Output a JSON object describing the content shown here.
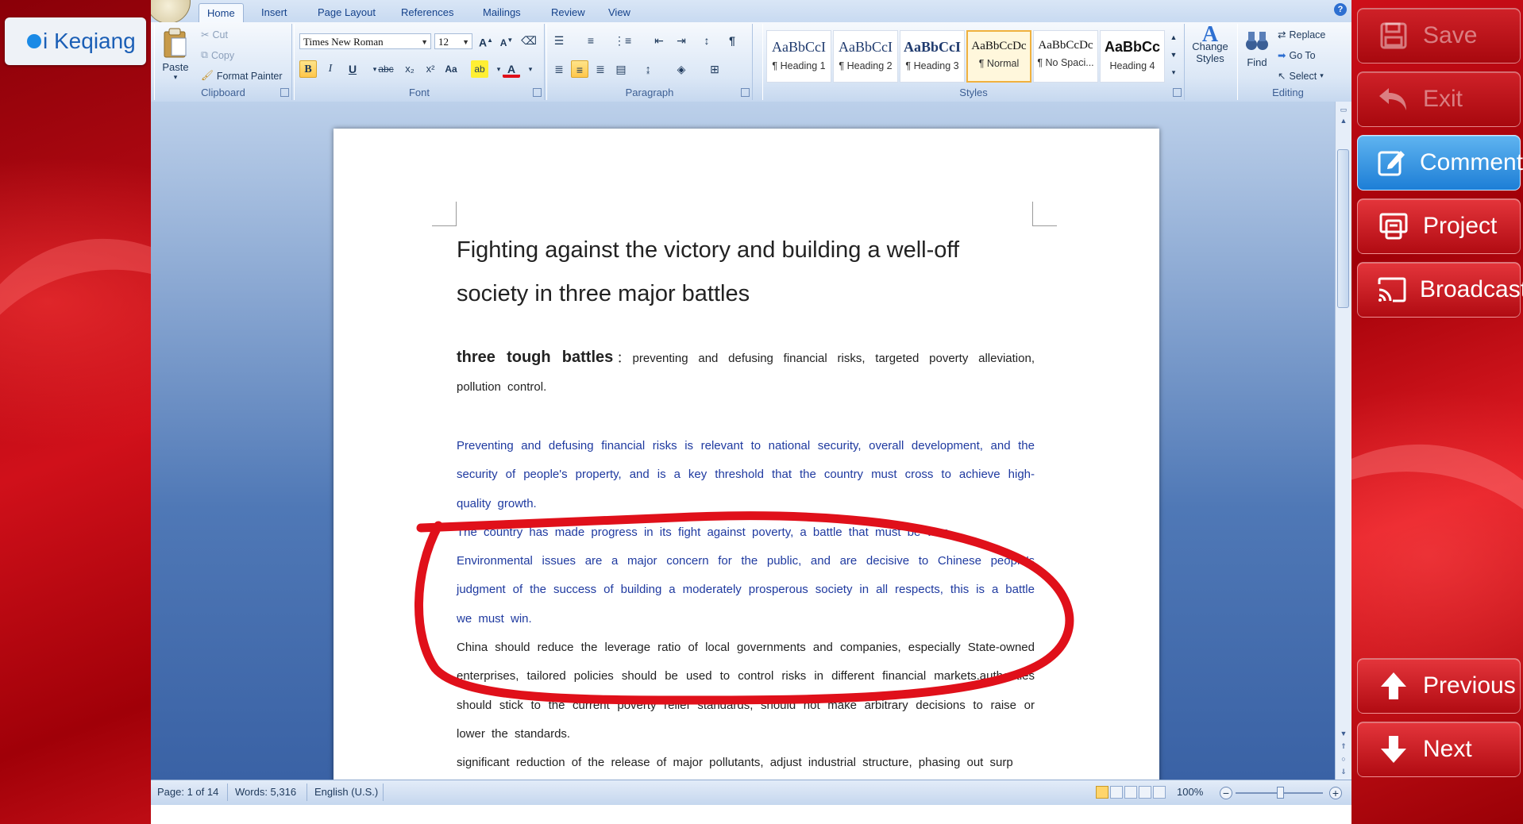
{
  "user": {
    "name": "i Keqiang"
  },
  "ribbon": {
    "tabs": [
      "Home",
      "Insert",
      "Page Layout",
      "References",
      "Mailings",
      "Review",
      "View"
    ],
    "clipboard": {
      "label": "Clipboard",
      "paste": "Paste",
      "cut": "Cut",
      "copy": "Copy",
      "format_painter": "Format Painter"
    },
    "font": {
      "label": "Font",
      "family": "Times New Roman",
      "size": "12",
      "bold": "B",
      "italic": "I",
      "underline": "U",
      "strike": "abc",
      "subscript": "x₂",
      "superscript": "x²",
      "change_case": "Aa"
    },
    "paragraph": {
      "label": "Paragraph"
    },
    "styles": {
      "label": "Styles",
      "items": [
        {
          "sample": "AaBbCcI",
          "name": "¶ Heading 1"
        },
        {
          "sample": "AaBbCcI",
          "name": "¶ Heading 2"
        },
        {
          "sample": "AaBbCcI",
          "name": "¶ Heading 3"
        },
        {
          "sample": "AaBbCcDc",
          "name": "¶ Normal"
        },
        {
          "sample": "AaBbCcDc",
          "name": "¶ No Spaci..."
        },
        {
          "sample": "AaBbCc",
          "name": "Heading 4"
        }
      ],
      "change_styles": "Change Styles"
    },
    "editing": {
      "label": "Editing",
      "find": "Find",
      "replace": "Replace",
      "goto": "Go To",
      "select": "Select"
    }
  },
  "document": {
    "title": "Fighting against the victory and building a well-off society in three major battles",
    "lead_bold": "three tough battles",
    "lead_rest": "：preventing and defusing financial risks, targeted poverty alleviation, pollution control.",
    "para1": "Preventing and defusing financial risks is relevant to national security, overall development, and the security of people's property, and is a key threshold that the country must cross to achieve high-quality growth.",
    "para2": "The country has made progress in its fight against poverty, a battle that must be won.",
    "para3": "Environmental issues are a major concern for the public, and are decisive to Chinese people's judgment of the success of building a moderately prosperous society in all respects, this is a battle we must win.",
    "para4": "China should reduce the leverage ratio of local governments and companies, especially State-owned enterprises, tailored policies should be used to control risks in different financial markets.authorities should stick to the current poverty relief standards, should not make arbitrary decisions to raise or lower the standards.",
    "para5": "significant reduction of the release of major pollutants, adjust industrial structure, phasing out surp"
  },
  "status": {
    "page": "Page: 1 of 14",
    "words": "Words: 5,316",
    "language": "English (U.S.)",
    "zoom": "100%"
  },
  "panel": {
    "save": "Save",
    "exit": "Exit",
    "comment": "Comment",
    "project": "Project",
    "broadcast": "Broadcast",
    "previous": "Previous",
    "next": "Next"
  },
  "colors": {
    "annotation": "#e0101a",
    "doc_blue_text": "#1f3aa0",
    "panel_red": "#c8141c",
    "panel_active": "#2b8be0"
  }
}
